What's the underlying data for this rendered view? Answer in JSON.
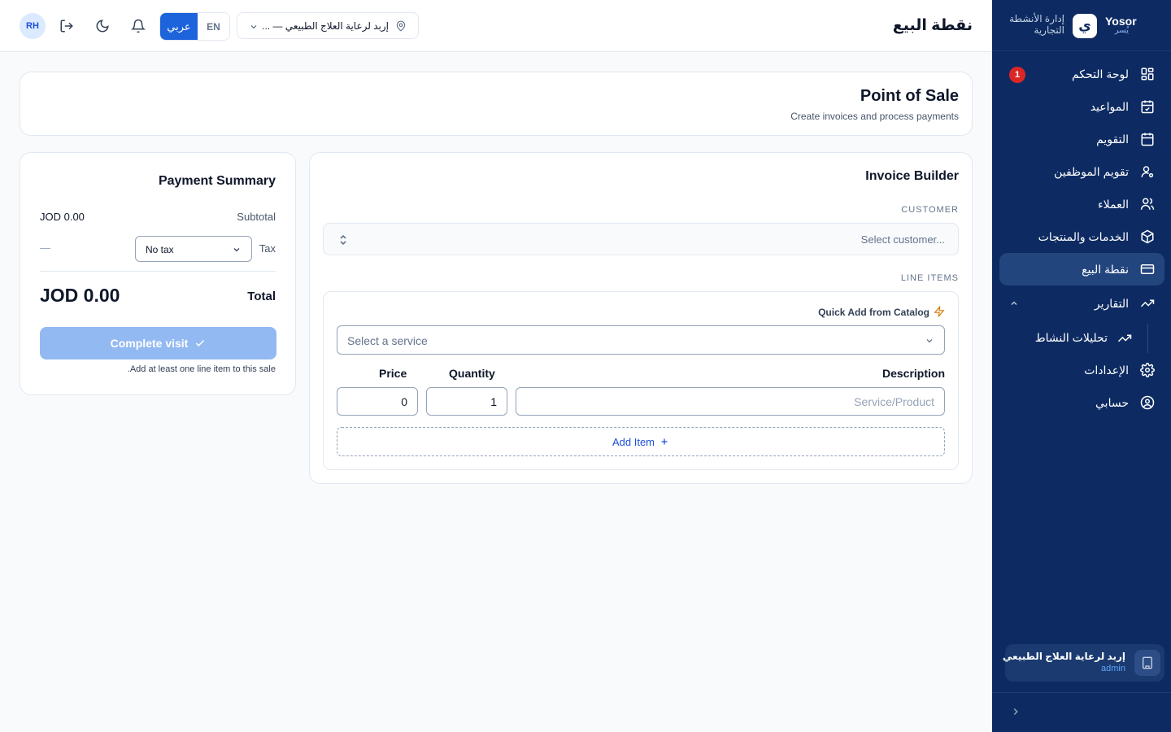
{
  "sidebar": {
    "brand_name": "Yosor",
    "brand_sub": "يُسر",
    "brand_logo": "ي",
    "brand_title": "إدارة الأنشطة التجارية",
    "items": [
      {
        "label": "لوحة التحكم",
        "icon": "dashboard-grid-icon",
        "badge": "1"
      },
      {
        "label": "المواعيد",
        "icon": "calendar-check-icon"
      },
      {
        "label": "التقويم",
        "icon": "calendar-icon"
      },
      {
        "label": "تقويم الموظفين",
        "icon": "user-cog-icon"
      },
      {
        "label": "العملاء",
        "icon": "users-icon"
      },
      {
        "label": "الخدمات والمنتجات",
        "icon": "package-icon"
      },
      {
        "label": "نقطة البيع",
        "icon": "credit-card-icon",
        "active": true
      },
      {
        "label": "التقارير",
        "icon": "trending-up-icon",
        "expanded": true
      },
      {
        "label": "الإعدادات",
        "icon": "gear-icon"
      },
      {
        "label": "حسابي",
        "icon": "user-circle-icon"
      }
    ],
    "sub_items": [
      {
        "label": "تحليلات النشاط",
        "icon": "trending-up-icon"
      }
    ],
    "org": {
      "name": "إربد لرعاية العلاج الطبيعي",
      "role": "admin"
    }
  },
  "header": {
    "title": "نقطة البيع",
    "avatar": "RH",
    "lang_ar": "عربي",
    "lang_en": "EN",
    "location": "إربد لرعاية العلاج الطبيعي — ..."
  },
  "hero": {
    "title": "Point of Sale",
    "subtitle": "Create invoices and process payments"
  },
  "invoice": {
    "title": "Invoice Builder",
    "customer_label": "CUSTOMER",
    "customer_placeholder": "Select customer...",
    "line_items_label": "LINE ITEMS",
    "quick_add": "Quick Add from Catalog",
    "service_placeholder": "Select a service",
    "columns": {
      "description": "Description",
      "quantity": "Quantity",
      "price": "Price"
    },
    "description_placeholder": "Service/Product",
    "quantity_value": "1",
    "price_value": "0",
    "add_item": "Add Item"
  },
  "summary": {
    "title": "Payment Summary",
    "subtotal_label": "Subtotal",
    "subtotal_value": "JOD 0.00",
    "tax_label": "Tax",
    "tax_option": "No tax",
    "tax_value": "—",
    "total_label": "Total",
    "total_value": "JOD 0.00",
    "complete_button": "Complete visit",
    "hint": "Add at least one line item to this sale."
  },
  "colors": {
    "sidebar_bg": "#0d2b62",
    "accent": "#1d63db",
    "badge": "#dc2626",
    "button_disabled": "#93b9f2"
  }
}
